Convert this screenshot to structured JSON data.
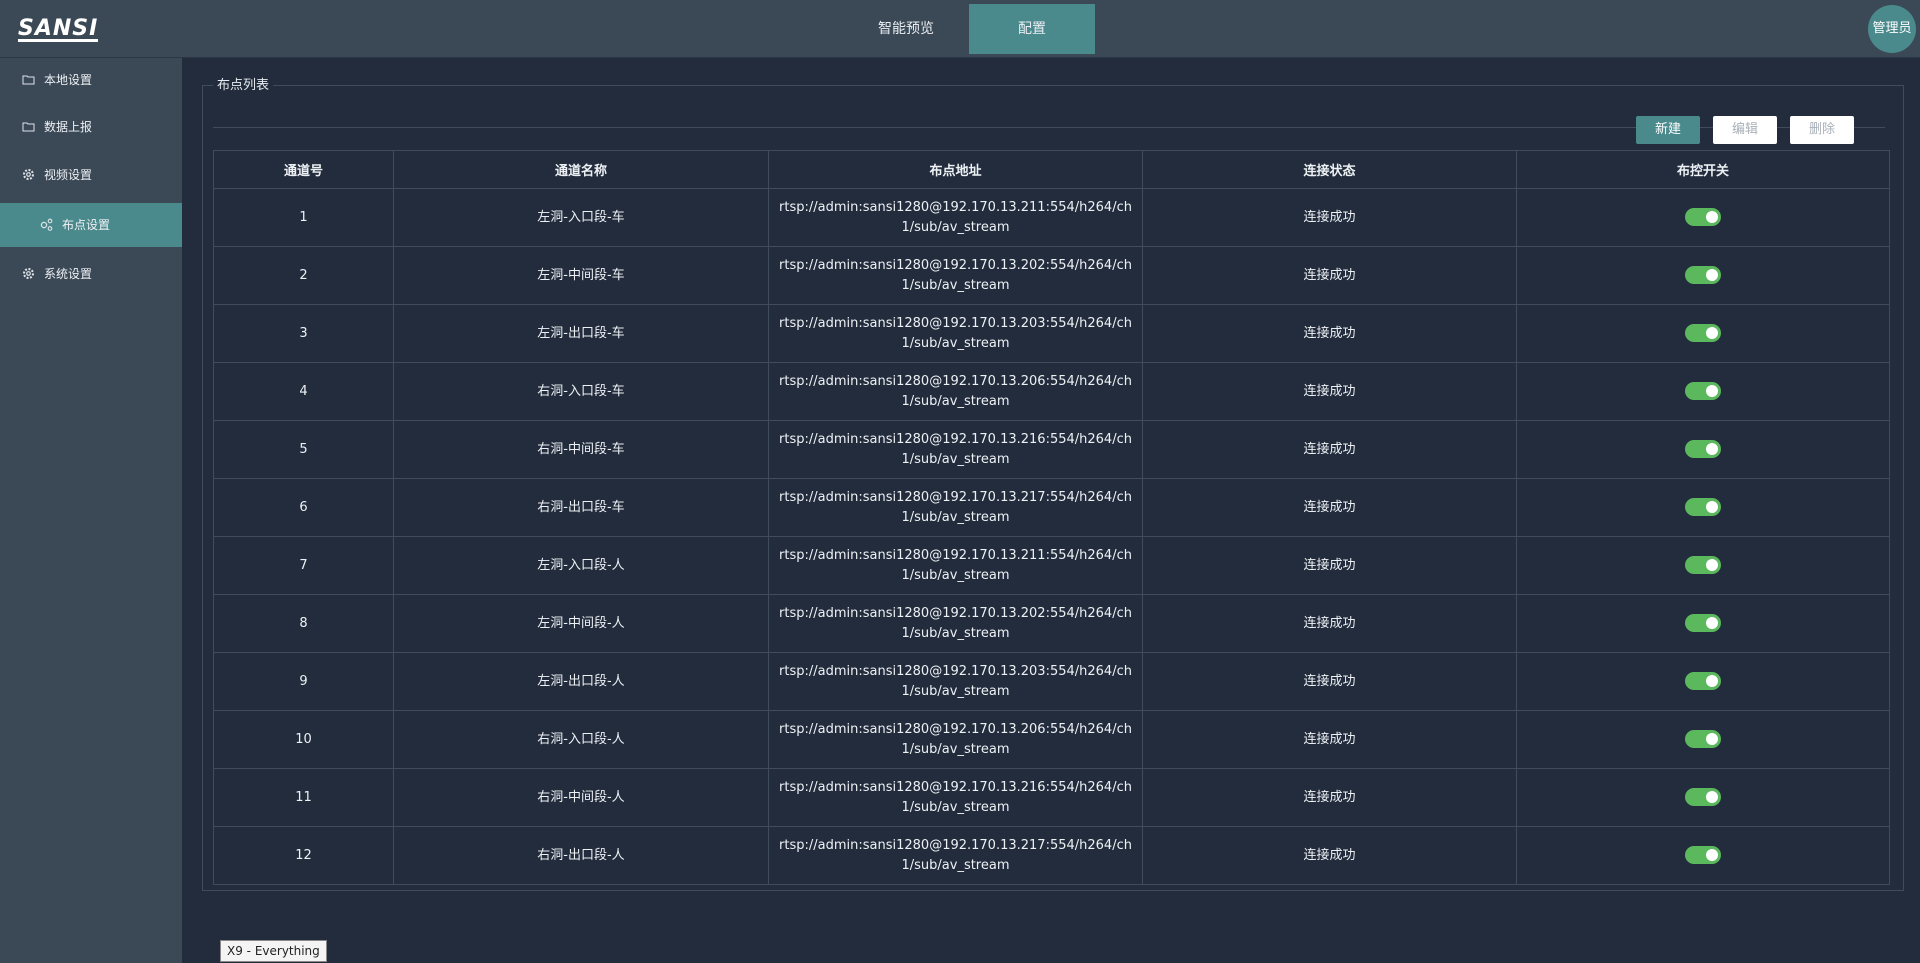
{
  "header": {
    "logo_text": "SANSI",
    "tabs": [
      {
        "label": "智能预览",
        "active": false
      },
      {
        "label": "配置",
        "active": true
      }
    ],
    "user": "管理员"
  },
  "sidebar": {
    "items": [
      {
        "label": "本地设置",
        "icon": "folder-icon"
      },
      {
        "label": "数据上报",
        "icon": "folder-icon"
      },
      {
        "label": "视频设置",
        "icon": "gear-icon"
      },
      {
        "label": "布点设置",
        "icon": "nodes-icon",
        "active": true
      },
      {
        "label": "系统设置",
        "icon": "gear-icon"
      }
    ]
  },
  "panel": {
    "title": "布点列表",
    "buttons": {
      "new": "新建",
      "edit": "编辑",
      "delete": "删除"
    },
    "columns": [
      "通道号",
      "通道名称",
      "布点地址",
      "连接状态",
      "布控开关"
    ],
    "rows": [
      {
        "no": "1",
        "name": "左洞-入口段-车",
        "addr": "rtsp://admin:sansi1280@192.170.13.211:554/h264/ch1/sub/av_stream",
        "status": "连接成功",
        "enabled": true
      },
      {
        "no": "2",
        "name": "左洞-中间段-车",
        "addr": "rtsp://admin:sansi1280@192.170.13.202:554/h264/ch1/sub/av_stream",
        "status": "连接成功",
        "enabled": true
      },
      {
        "no": "3",
        "name": "左洞-出口段-车",
        "addr": "rtsp://admin:sansi1280@192.170.13.203:554/h264/ch1/sub/av_stream",
        "status": "连接成功",
        "enabled": true
      },
      {
        "no": "4",
        "name": "右洞-入口段-车",
        "addr": "rtsp://admin:sansi1280@192.170.13.206:554/h264/ch1/sub/av_stream",
        "status": "连接成功",
        "enabled": true
      },
      {
        "no": "5",
        "name": "右洞-中间段-车",
        "addr": "rtsp://admin:sansi1280@192.170.13.216:554/h264/ch1/sub/av_stream",
        "status": "连接成功",
        "enabled": true
      },
      {
        "no": "6",
        "name": "右洞-出口段-车",
        "addr": "rtsp://admin:sansi1280@192.170.13.217:554/h264/ch1/sub/av_stream",
        "status": "连接成功",
        "enabled": true
      },
      {
        "no": "7",
        "name": "左洞-入口段-人",
        "addr": "rtsp://admin:sansi1280@192.170.13.211:554/h264/ch1/sub/av_stream",
        "status": "连接成功",
        "enabled": true
      },
      {
        "no": "8",
        "name": "左洞-中间段-人",
        "addr": "rtsp://admin:sansi1280@192.170.13.202:554/h264/ch1/sub/av_stream",
        "status": "连接成功",
        "enabled": true
      },
      {
        "no": "9",
        "name": "左洞-出口段-人",
        "addr": "rtsp://admin:sansi1280@192.170.13.203:554/h264/ch1/sub/av_stream",
        "status": "连接成功",
        "enabled": true
      },
      {
        "no": "10",
        "name": "右洞-入口段-人",
        "addr": "rtsp://admin:sansi1280@192.170.13.206:554/h264/ch1/sub/av_stream",
        "status": "连接成功",
        "enabled": true
      },
      {
        "no": "11",
        "name": "右洞-中间段-人",
        "addr": "rtsp://admin:sansi1280@192.170.13.216:554/h264/ch1/sub/av_stream",
        "status": "连接成功",
        "enabled": true
      },
      {
        "no": "12",
        "name": "右洞-出口段-人",
        "addr": "rtsp://admin:sansi1280@192.170.13.217:554/h264/ch1/sub/av_stream",
        "status": "连接成功",
        "enabled": true
      }
    ]
  },
  "tooltip": "X9 - Everything",
  "colors": {
    "accent": "#4b8a8c",
    "toggle_on": "#5cb85c",
    "background": "#222c3d",
    "sidebar": "#3b4957"
  }
}
